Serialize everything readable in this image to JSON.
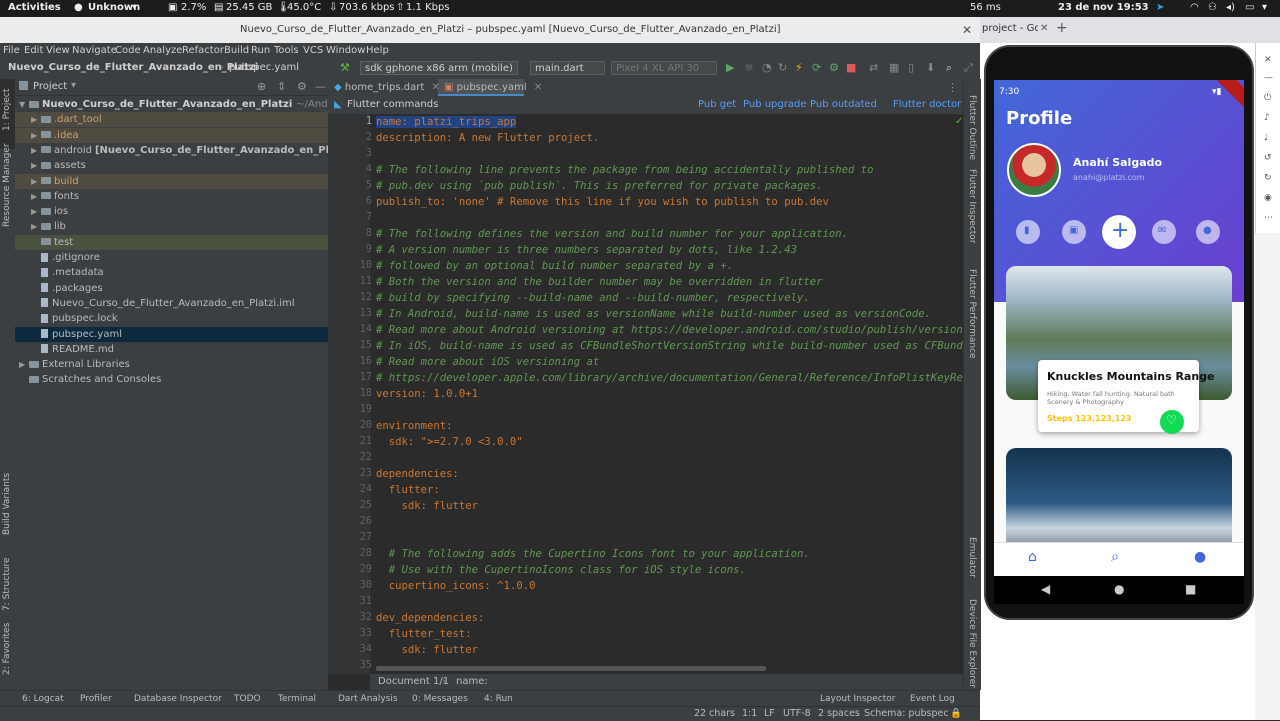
{
  "os_bar": {
    "activities": "Activities",
    "unknown": "Unknown",
    "cpu": "2.7%",
    "mem": "25.45 GB",
    "temp": "45.0°C",
    "net_down": "703.6 kbps",
    "net_up": "1.1 Kbps",
    "ping": "56 ms",
    "datetime": "23 de nov  19:53"
  },
  "window": {
    "title": "Nuevo_Curso_de_Flutter_Avanzado_en_Platzi – pubspec.yaml [Nuevo_Curso_de_Flutter_Avanzado_en_Platzi]",
    "close": "✕"
  },
  "browser": {
    "tab_label": "project - Go",
    "new_tab": "+",
    "close": "✕"
  },
  "menu": [
    "File",
    "Edit",
    "View",
    "Navigate",
    "Code",
    "Analyze",
    "Refactor",
    "Build",
    "Run",
    "Tools",
    "VCS",
    "Window",
    "Help"
  ],
  "navbar": {
    "project": "Nuevo_Curso_de_Flutter_Avanzado_en_Platzi",
    "file": "pubspec.yaml",
    "device": "sdk gphone x86 arm (mobile)",
    "config": "main.dart",
    "avd": "Pixel 4 XL API 30"
  },
  "left_strip": {
    "project": "1: Project",
    "resource_manager": "Resource Manager",
    "build_variants": "Build Variants",
    "structure": "7: Structure",
    "favorites": "2: Favorites"
  },
  "project_panel": {
    "header": "Project",
    "root": "Nuevo_Curso_de_Flutter_Avanzado_en_Platzi",
    "root_path": "~/AndroidStudio",
    "items": [
      {
        "label": ".dart_tool",
        "type": "folder"
      },
      {
        "label": ".idea",
        "type": "folder"
      },
      {
        "label": "android",
        "extra": "[Nuevo_Curso_de_Flutter_Avanzado_en_Platzi_andr",
        "type": "folder"
      },
      {
        "label": "assets",
        "type": "folder"
      },
      {
        "label": "build",
        "type": "folder"
      },
      {
        "label": "fonts",
        "type": "folder"
      },
      {
        "label": "ios",
        "type": "folder"
      },
      {
        "label": "lib",
        "type": "folder"
      },
      {
        "label": "test",
        "type": "folder"
      },
      {
        "label": ".gitignore",
        "type": "file"
      },
      {
        "label": ".metadata",
        "type": "file"
      },
      {
        "label": ".packages",
        "type": "file"
      },
      {
        "label": "Nuevo_Curso_de_Flutter_Avanzado_en_Platzi.iml",
        "type": "file"
      },
      {
        "label": "pubspec.lock",
        "type": "file"
      },
      {
        "label": "pubspec.yaml",
        "type": "file"
      },
      {
        "label": "README.md",
        "type": "file"
      }
    ],
    "external": "External Libraries",
    "scratches": "Scratches and Consoles"
  },
  "editor": {
    "tabs": [
      {
        "label": "home_trips.dart"
      },
      {
        "label": "pubspec.yaml"
      }
    ],
    "flutter_commands": "Flutter commands",
    "pub_get": "Pub get",
    "pub_upgrade": "Pub upgrade",
    "pub_outdated": "Pub outdated",
    "flutter_doctor": "Flutter doctor",
    "lines": [
      "name: platzi_trips_app",
      "description: A new Flutter project.",
      "",
      "# The following line prevents the package from being accidentally published to",
      "# pub.dev using `pub publish`. This is preferred for private packages.",
      "publish_to: 'none' # Remove this line if you wish to publish to pub.dev",
      "",
      "# The following defines the version and build number for your application.",
      "# A version number is three numbers separated by dots, like 1.2.43",
      "# followed by an optional build number separated by a +.",
      "# Both the version and the builder number may be overridden in flutter",
      "# build by specifying --build-name and --build-number, respectively.",
      "# In Android, build-name is used as versionName while build-number used as versionCode.",
      "# Read more about Android versioning at https://developer.android.com/studio/publish/versioni",
      "# In iOS, build-name is used as CFBundleShortVersionString while build-number used as CFBundl",
      "# Read more about iOS versioning at",
      "# https://developer.apple.com/library/archive/documentation/General/Reference/InfoPlistKeyRef",
      "version: 1.0.0+1",
      "",
      "environment:",
      "  sdk: \">=2.7.0 <3.0.0\"",
      "",
      "dependencies:",
      "  flutter:",
      "    sdk: flutter",
      "",
      "",
      "  # The following adds the Cupertino Icons font to your application.",
      "  # Use with the CupertinoIcons class for iOS style icons.",
      "  cupertino_icons: ^1.0.0",
      "",
      "dev_dependencies:",
      "  flutter_test:",
      "    sdk: flutter",
      ""
    ],
    "breadcrumb_doc": "Document 1/1",
    "breadcrumb_name": "name:"
  },
  "right_strip": {
    "outline": "Flutter Outline",
    "inspector": "Flutter Inspector",
    "performance": "Flutter Performance",
    "emulator": "Emulator",
    "device_file_explorer": "Device File Explorer"
  },
  "bottom_tools": {
    "logcat": "6: Logcat",
    "profiler": "Profiler",
    "db": "Database Inspector",
    "todo": "TODO",
    "terminal": "Terminal",
    "dart": "Dart Analysis",
    "messages": "0: Messages",
    "run": "4: Run",
    "layout": "Layout Inspector",
    "event_log": "Event Log"
  },
  "status": {
    "chars": "22 chars",
    "pos": "1:1",
    "lf": "LF",
    "enc": "UTF-8",
    "indent": "2 spaces",
    "schema": "Schema: pubspec"
  },
  "phone": {
    "time": "7:30",
    "title": "Profile",
    "user_name": "Anahí Salgado",
    "user_email": "anahi@platzi.com",
    "card_title": "Knuckles Mountains Range",
    "card_desc": "Hiking. Water fall hunting. Natural bath Scenery & Photography",
    "card_steps": "Steps 123,123,123"
  },
  "colors": {
    "accent": "#4267d8",
    "heart": "#11da53",
    "steps": "#ffc107",
    "selected_row": "#0d293e"
  }
}
